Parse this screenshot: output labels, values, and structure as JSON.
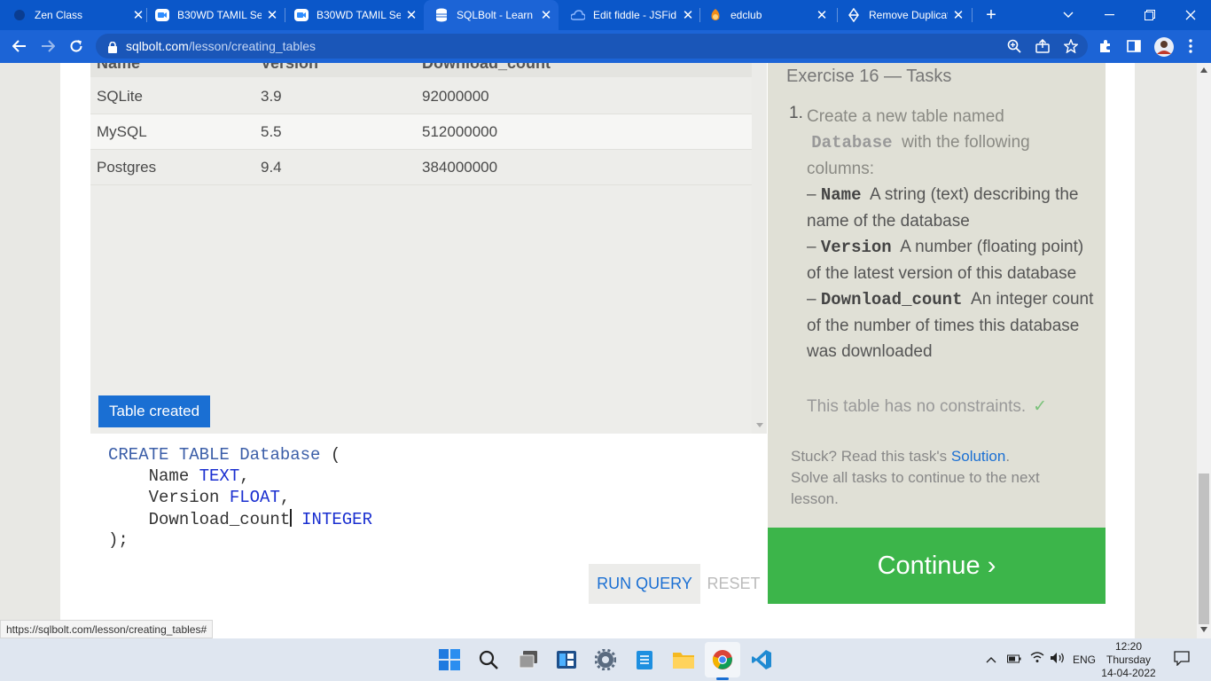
{
  "browser": {
    "tabs": [
      {
        "title": "Zen Class",
        "icon": "zen-icon"
      },
      {
        "title": "B30WD TAMIL Se",
        "icon": "zoom-icon"
      },
      {
        "title": "B30WD TAMIL Se",
        "icon": "zoom-icon"
      },
      {
        "title": "SQLBolt - Learn S",
        "icon": "sqlbolt-icon"
      },
      {
        "title": "Edit fiddle - JSFid",
        "icon": "jsfiddle-icon"
      },
      {
        "title": "edclub",
        "icon": "edclub-icon"
      },
      {
        "title": "Remove Duplicat",
        "icon": "blog-icon"
      }
    ],
    "url_host": "sqlbolt.com",
    "url_path": "/lesson/creating_tables",
    "status_url": "https://sqlbolt.com/lesson/creating_tables#"
  },
  "results": {
    "columns": [
      "Name",
      "Version",
      "Download_count"
    ],
    "rows": [
      [
        "SQLite",
        "3.9",
        "92000000"
      ],
      [
        "MySQL",
        "5.5",
        "512000000"
      ],
      [
        "Postgres",
        "9.4",
        "384000000"
      ]
    ],
    "status": "Table created"
  },
  "editor": {
    "line1_kw": "CREATE TABLE",
    "line1_name": "Database",
    "line1_paren": "(",
    "line2_col": "Name",
    "line2_type": "TEXT",
    "line3_col": "Version",
    "line3_type": "FLOAT",
    "line4_col": "Download_count",
    "line4_type": "INTEGER",
    "line5": ");",
    "comma": ",",
    "run_label": "RUN QUERY",
    "reset_label": "RESET"
  },
  "tasks": {
    "title": "Exercise 16 — Tasks",
    "number": "1.",
    "intro": "Create a new table named",
    "table_name": "Database",
    "intro_end": "with the following columns:",
    "dash": "–",
    "col1_name": "Name",
    "col1_desc": "A string (text) describing the name of the database",
    "col2_name": "Version",
    "col2_desc": "A number (floating point) of the latest version of this database",
    "col3_name": "Download_count",
    "col3_desc": "An integer count of the number of times this database was downloaded",
    "constraint": "This table has no constraints.",
    "check": "✓",
    "stuck_prefix": "Stuck? Read this task's",
    "solution_label": "Solution",
    "stuck_suffix": ".",
    "stuck_line2": "Solve all tasks to continue to the next lesson.",
    "continue_label": "Continue ›"
  },
  "taskbar": {
    "lang": "ENG",
    "time": "12:20",
    "day": "Thursday",
    "date": "14-04-2022"
  },
  "colors": {
    "chrome_blue": "#1c64d6",
    "link_blue": "#1a6fd3",
    "continue_green": "#3cb54a",
    "tasks_bg": "#e0e0d6"
  }
}
